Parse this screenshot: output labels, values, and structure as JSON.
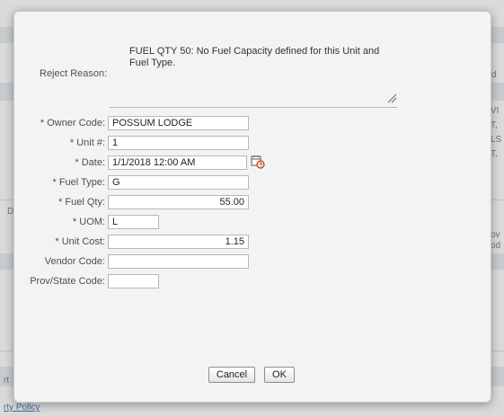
{
  "background": {
    "right_fragments": [
      "d",
      "VI",
      "T,",
      "LS",
      "T,",
      "ov",
      "od"
    ],
    "left_fragments": [
      "D",
      "rt"
    ],
    "footer_link": "rty Policy"
  },
  "dialog": {
    "reject_reason": {
      "label": "Reject Reason:",
      "value": "FUEL QTY 50: No Fuel Capacity defined for this Unit and Fuel Type."
    },
    "fields": [
      {
        "key": "owner_code",
        "label": "Owner Code:",
        "required": true,
        "value": "POSSUM LODGE"
      },
      {
        "key": "unit_no",
        "label": "Unit #:",
        "required": true,
        "value": "1"
      },
      {
        "key": "date",
        "label": "Date:",
        "required": true,
        "value": "1/1/2018 12:00 AM"
      },
      {
        "key": "fuel_type",
        "label": "Fuel Type:",
        "required": true,
        "value": "G"
      },
      {
        "key": "fuel_qty",
        "label": "Fuel Qty:",
        "required": true,
        "value": "55.00"
      },
      {
        "key": "uom",
        "label": "UOM:",
        "required": true,
        "value": "L"
      },
      {
        "key": "unit_cost",
        "label": "Unit Cost:",
        "required": true,
        "value": "1.15"
      },
      {
        "key": "vendor_code",
        "label": "Vendor Code:",
        "required": false,
        "value": ""
      },
      {
        "key": "prov_state_code",
        "label": "Prov/State Code:",
        "required": false,
        "value": ""
      }
    ],
    "required_marker": "* ",
    "buttons": {
      "cancel": "Cancel",
      "ok": "OK"
    }
  }
}
